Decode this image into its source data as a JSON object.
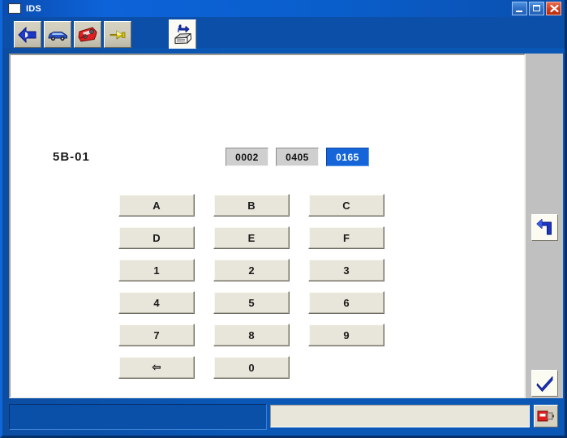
{
  "window": {
    "title": "IDS",
    "icon": "window-icon",
    "controls": [
      {
        "name": "minimize-button",
        "label": "_"
      },
      {
        "name": "maximize-button",
        "label": "□"
      },
      {
        "name": "close-button",
        "label": "✕"
      }
    ]
  },
  "toolbar": {
    "tabs": [
      {
        "name": "tab-back",
        "icon": "blue-left-arrow-icon",
        "selected": false
      },
      {
        "name": "tab-vehicle",
        "icon": "blue-car-icon",
        "selected": false
      },
      {
        "name": "tab-tools",
        "icon": "red-toolbox-icon",
        "selected": false
      },
      {
        "name": "tab-connector",
        "icon": "yellow-plug-icon",
        "selected": false
      },
      {
        "name": "tab-information",
        "icon": "info-book-icon",
        "selected": true
      }
    ]
  },
  "main": {
    "code_label": "5B-01",
    "value_boxes": [
      {
        "name": "value-box-1",
        "value": "0002",
        "active": false
      },
      {
        "name": "value-box-2",
        "value": "0405",
        "active": false
      },
      {
        "name": "value-box-3",
        "value": "0165",
        "active": true
      }
    ],
    "keypad": [
      {
        "name": "key-a",
        "label": "A"
      },
      {
        "name": "key-b",
        "label": "B"
      },
      {
        "name": "key-c",
        "label": "C"
      },
      {
        "name": "key-d",
        "label": "D"
      },
      {
        "name": "key-e",
        "label": "E"
      },
      {
        "name": "key-f",
        "label": "F"
      },
      {
        "name": "key-1",
        "label": "1"
      },
      {
        "name": "key-2",
        "label": "2"
      },
      {
        "name": "key-3",
        "label": "3"
      },
      {
        "name": "key-4",
        "label": "4"
      },
      {
        "name": "key-5",
        "label": "5"
      },
      {
        "name": "key-6",
        "label": "6"
      },
      {
        "name": "key-7",
        "label": "7"
      },
      {
        "name": "key-8",
        "label": "8"
      },
      {
        "name": "key-9",
        "label": "9"
      },
      {
        "name": "key-backspace",
        "label": "⇦"
      },
      {
        "name": "key-0",
        "label": "0"
      },
      {
        "name": "key-blank",
        "label": "",
        "empty": true
      }
    ]
  },
  "right_rail": {
    "back_button": {
      "name": "back-arrow-button",
      "icon": "blue-undo-arrow-icon"
    },
    "confirm_button": {
      "name": "confirm-check-button",
      "icon": "blue-checkmark-icon"
    }
  },
  "status_bar": {
    "message": "",
    "icon": "red-vci-connector-icon"
  },
  "colors": {
    "title_bar": "#0a57b5",
    "window_body": "#0b4fa8",
    "panel": "#ffffff",
    "rail": "#c0c0c0",
    "button_face": "#e8e6da",
    "accent_blue": "#1565d8",
    "close_red": "#d23c1a"
  }
}
